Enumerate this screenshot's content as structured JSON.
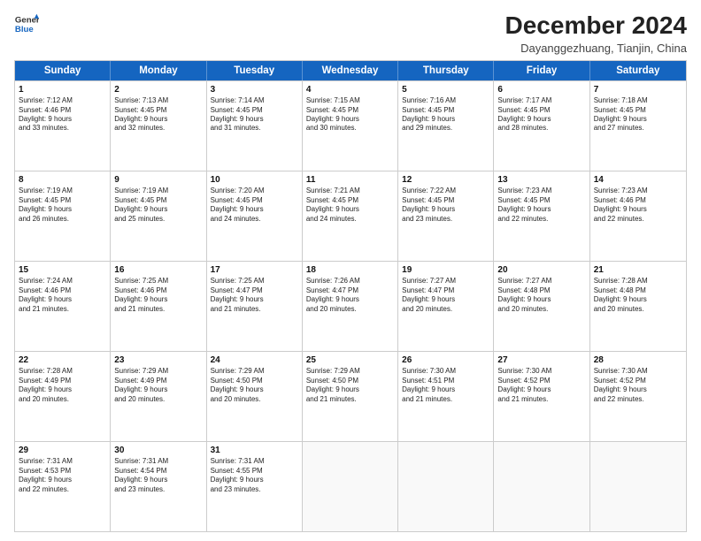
{
  "logo": {
    "line1": "General",
    "line2": "Blue"
  },
  "title": "December 2024",
  "location": "Dayanggezhuang, Tianjin, China",
  "header_days": [
    "Sunday",
    "Monday",
    "Tuesday",
    "Wednesday",
    "Thursday",
    "Friday",
    "Saturday"
  ],
  "rows": [
    [
      {
        "day": "1",
        "text": "Sunrise: 7:12 AM\nSunset: 4:46 PM\nDaylight: 9 hours\nand 33 minutes."
      },
      {
        "day": "2",
        "text": "Sunrise: 7:13 AM\nSunset: 4:45 PM\nDaylight: 9 hours\nand 32 minutes."
      },
      {
        "day": "3",
        "text": "Sunrise: 7:14 AM\nSunset: 4:45 PM\nDaylight: 9 hours\nand 31 minutes."
      },
      {
        "day": "4",
        "text": "Sunrise: 7:15 AM\nSunset: 4:45 PM\nDaylight: 9 hours\nand 30 minutes."
      },
      {
        "day": "5",
        "text": "Sunrise: 7:16 AM\nSunset: 4:45 PM\nDaylight: 9 hours\nand 29 minutes."
      },
      {
        "day": "6",
        "text": "Sunrise: 7:17 AM\nSunset: 4:45 PM\nDaylight: 9 hours\nand 28 minutes."
      },
      {
        "day": "7",
        "text": "Sunrise: 7:18 AM\nSunset: 4:45 PM\nDaylight: 9 hours\nand 27 minutes."
      }
    ],
    [
      {
        "day": "8",
        "text": "Sunrise: 7:19 AM\nSunset: 4:45 PM\nDaylight: 9 hours\nand 26 minutes."
      },
      {
        "day": "9",
        "text": "Sunrise: 7:19 AM\nSunset: 4:45 PM\nDaylight: 9 hours\nand 25 minutes."
      },
      {
        "day": "10",
        "text": "Sunrise: 7:20 AM\nSunset: 4:45 PM\nDaylight: 9 hours\nand 24 minutes."
      },
      {
        "day": "11",
        "text": "Sunrise: 7:21 AM\nSunset: 4:45 PM\nDaylight: 9 hours\nand 24 minutes."
      },
      {
        "day": "12",
        "text": "Sunrise: 7:22 AM\nSunset: 4:45 PM\nDaylight: 9 hours\nand 23 minutes."
      },
      {
        "day": "13",
        "text": "Sunrise: 7:23 AM\nSunset: 4:45 PM\nDaylight: 9 hours\nand 22 minutes."
      },
      {
        "day": "14",
        "text": "Sunrise: 7:23 AM\nSunset: 4:46 PM\nDaylight: 9 hours\nand 22 minutes."
      }
    ],
    [
      {
        "day": "15",
        "text": "Sunrise: 7:24 AM\nSunset: 4:46 PM\nDaylight: 9 hours\nand 21 minutes."
      },
      {
        "day": "16",
        "text": "Sunrise: 7:25 AM\nSunset: 4:46 PM\nDaylight: 9 hours\nand 21 minutes."
      },
      {
        "day": "17",
        "text": "Sunrise: 7:25 AM\nSunset: 4:47 PM\nDaylight: 9 hours\nand 21 minutes."
      },
      {
        "day": "18",
        "text": "Sunrise: 7:26 AM\nSunset: 4:47 PM\nDaylight: 9 hours\nand 20 minutes."
      },
      {
        "day": "19",
        "text": "Sunrise: 7:27 AM\nSunset: 4:47 PM\nDaylight: 9 hours\nand 20 minutes."
      },
      {
        "day": "20",
        "text": "Sunrise: 7:27 AM\nSunset: 4:48 PM\nDaylight: 9 hours\nand 20 minutes."
      },
      {
        "day": "21",
        "text": "Sunrise: 7:28 AM\nSunset: 4:48 PM\nDaylight: 9 hours\nand 20 minutes."
      }
    ],
    [
      {
        "day": "22",
        "text": "Sunrise: 7:28 AM\nSunset: 4:49 PM\nDaylight: 9 hours\nand 20 minutes."
      },
      {
        "day": "23",
        "text": "Sunrise: 7:29 AM\nSunset: 4:49 PM\nDaylight: 9 hours\nand 20 minutes."
      },
      {
        "day": "24",
        "text": "Sunrise: 7:29 AM\nSunset: 4:50 PM\nDaylight: 9 hours\nand 20 minutes."
      },
      {
        "day": "25",
        "text": "Sunrise: 7:29 AM\nSunset: 4:50 PM\nDaylight: 9 hours\nand 21 minutes."
      },
      {
        "day": "26",
        "text": "Sunrise: 7:30 AM\nSunset: 4:51 PM\nDaylight: 9 hours\nand 21 minutes."
      },
      {
        "day": "27",
        "text": "Sunrise: 7:30 AM\nSunset: 4:52 PM\nDaylight: 9 hours\nand 21 minutes."
      },
      {
        "day": "28",
        "text": "Sunrise: 7:30 AM\nSunset: 4:52 PM\nDaylight: 9 hours\nand 22 minutes."
      }
    ],
    [
      {
        "day": "29",
        "text": "Sunrise: 7:31 AM\nSunset: 4:53 PM\nDaylight: 9 hours\nand 22 minutes."
      },
      {
        "day": "30",
        "text": "Sunrise: 7:31 AM\nSunset: 4:54 PM\nDaylight: 9 hours\nand 23 minutes."
      },
      {
        "day": "31",
        "text": "Sunrise: 7:31 AM\nSunset: 4:55 PM\nDaylight: 9 hours\nand 23 minutes."
      },
      {
        "day": "",
        "text": ""
      },
      {
        "day": "",
        "text": ""
      },
      {
        "day": "",
        "text": ""
      },
      {
        "day": "",
        "text": ""
      }
    ]
  ]
}
